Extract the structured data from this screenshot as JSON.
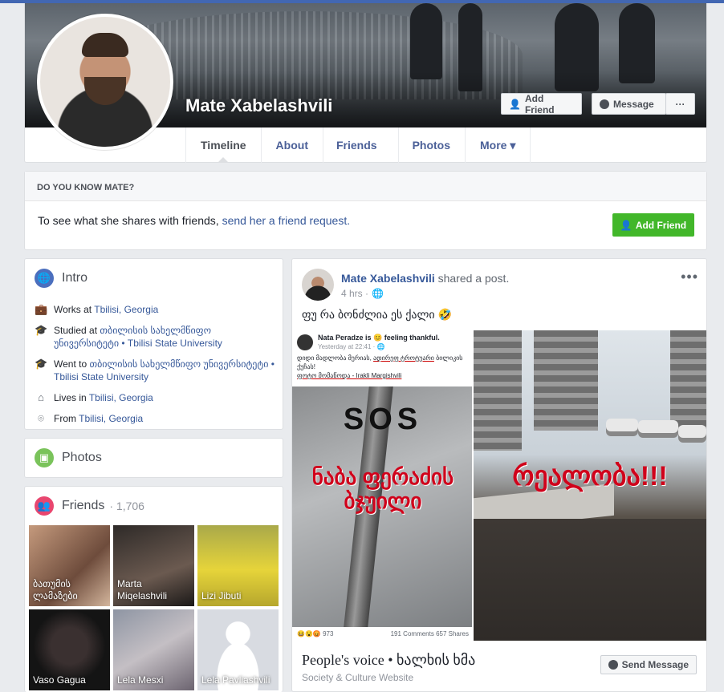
{
  "colors": {
    "fb_blue": "#4267b2",
    "link": "#365899",
    "green": "#42b72a",
    "red_text": "#d0021b"
  },
  "profile": {
    "name": "Mate Xabelashvili",
    "add_friend_label": "Add Friend",
    "message_label": "Message",
    "more_label": "···"
  },
  "tabs": [
    "Timeline",
    "About",
    "Friends",
    "Photos",
    "More ▾"
  ],
  "know": {
    "heading": "DO YOU KNOW MATE?",
    "text": "To see what she shares with friends,",
    "link": "send her a friend request.",
    "button": "Add Friend"
  },
  "intro": {
    "title": "Intro",
    "items": [
      {
        "icon": "briefcase-icon",
        "prefix": "Works at ",
        "link": "Tbilisi, Georgia"
      },
      {
        "icon": "graduation-cap-icon",
        "prefix": "Studied at ",
        "link": "თბილისის სახელმწიფო უნივერსიტეტი • Tbilisi State University"
      },
      {
        "icon": "graduation-cap-icon",
        "prefix": "Went to ",
        "link": "თბილისის სახელმწიფო უნივერსიტეტი • Tbilisi State University"
      },
      {
        "icon": "home-icon",
        "prefix": "Lives in ",
        "link": "Tbilisi, Georgia"
      },
      {
        "icon": "location-pin-icon",
        "prefix": "From ",
        "link": "Tbilisi, Georgia"
      }
    ]
  },
  "photos": {
    "title": "Photos"
  },
  "friends": {
    "title": "Friends",
    "count": "· 1,706",
    "list": [
      {
        "name": "ბათუმის ლამაზები"
      },
      {
        "name": "Marta Miqelashvili"
      },
      {
        "name": "Lizi Jibuti"
      },
      {
        "name": "Vaso Gagua"
      },
      {
        "name": "Lela Mesxi"
      },
      {
        "name": "Lela Pavliashvili"
      }
    ]
  },
  "post": {
    "author": "Mate Xabelashvili",
    "action": "shared a post.",
    "time": "4 hrs ·",
    "text": "ფუ რა ბონძლია ეს ქალი 🤣",
    "shot": {
      "name": "Nata Peradze is 😊 feeling thankful.",
      "time": "Yesterday at 22:41 · 🌐",
      "body1": "დიდი მადლობა მერიას, ",
      "body_underline": "ადირეფ ტროტუარი",
      "body2": " ბილიკის ქუჩას!",
      "body3": "ფოტო მომაწოდა - Irakli Margishvili",
      "sos": "SOS",
      "red_left": "ნაბა ფერაძის ბჯუილი",
      "reactions": "😆😮😡 973",
      "comments": "191 Comments   657 Shares"
    },
    "red_right": "რეალობა!!!",
    "page_title": "People's voice • ხალხის ხმა",
    "page_category": "Society & Culture Website",
    "send_message": "Send Message"
  }
}
